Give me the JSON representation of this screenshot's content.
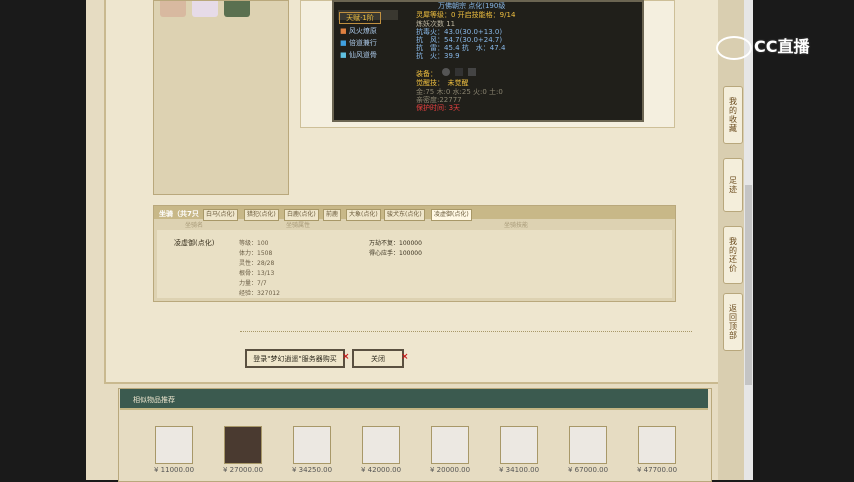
{
  "watermark": {
    "text": "CC直播"
  },
  "side_nav": {
    "items": [
      {
        "label": "我的收藏"
      },
      {
        "label": "足迹"
      },
      {
        "label": "我的还价"
      },
      {
        "label": "返回顶部"
      }
    ]
  },
  "tooltip": {
    "top_title": "万佛朝宗 点化(190级",
    "talent": "天赋·1阶",
    "skills": [
      "风火燎原",
      "倍道兼行",
      "仙风道骨"
    ],
    "lines": [
      {
        "text": "灵犀等级：0 开启技能格：9/14",
        "color": "#f0c040"
      },
      {
        "text": "炼妖次数 11",
        "color": "#bdb6a0"
      },
      {
        "text": "抗毒火：43.0(30.0+13.0)",
        "color": "#88b8e8"
      },
      {
        "text": "抗　风：54.7(30.0+24.7)",
        "color": "#88b8e8"
      },
      {
        "text": "抗　雷：45.4 抗　水：47.4",
        "color": "#88b8e8"
      },
      {
        "text": "抗　火：39.9",
        "color": "#88b8e8"
      },
      {
        "text": "装备：",
        "color": "#f0c040"
      },
      {
        "text": "觉醒技：　未觉醒",
        "color": "#f0c040"
      },
      {
        "text": "金:75 木:0 水:25 火:0 土:0",
        "color": "#8a8470"
      },
      {
        "text": "亲密度:22777",
        "color": "#8a8470"
      },
      {
        "text": "保护时间: 3天",
        "color": "#e84040"
      }
    ]
  },
  "mount": {
    "header": "坐骑（共7只",
    "tabs": [
      "白马(点化)",
      "猎犯(点化)",
      "白鹿(点化)",
      "前鹿",
      "大象(点化)",
      "骏犬东(点化)",
      "凌虚御(点化)"
    ],
    "sub_headers": [
      "坐骑名",
      "坐骑属性",
      "坐骑技能"
    ],
    "name": "凌虚御(点化)",
    "stats": [
      "等级：100",
      "体力：1508",
      "灵性：28/28",
      "根骨：13/13",
      "力量：7/7",
      "经验：327012"
    ],
    "skills": [
      "万劫不复：100000",
      "得心应手：100000"
    ]
  },
  "buttons": {
    "login": "登录\"梦幻逍遥\"服务器购买",
    "close": "关闭"
  },
  "recommend": {
    "title": "相似物品推荐",
    "prices": [
      "¥ 11000.00",
      "¥ 27000.00",
      "¥ 34250.00",
      "¥ 42000.00",
      "¥ 20000.00",
      "¥ 34100.00",
      "¥ 67000.00",
      "¥ 47700.00"
    ]
  }
}
